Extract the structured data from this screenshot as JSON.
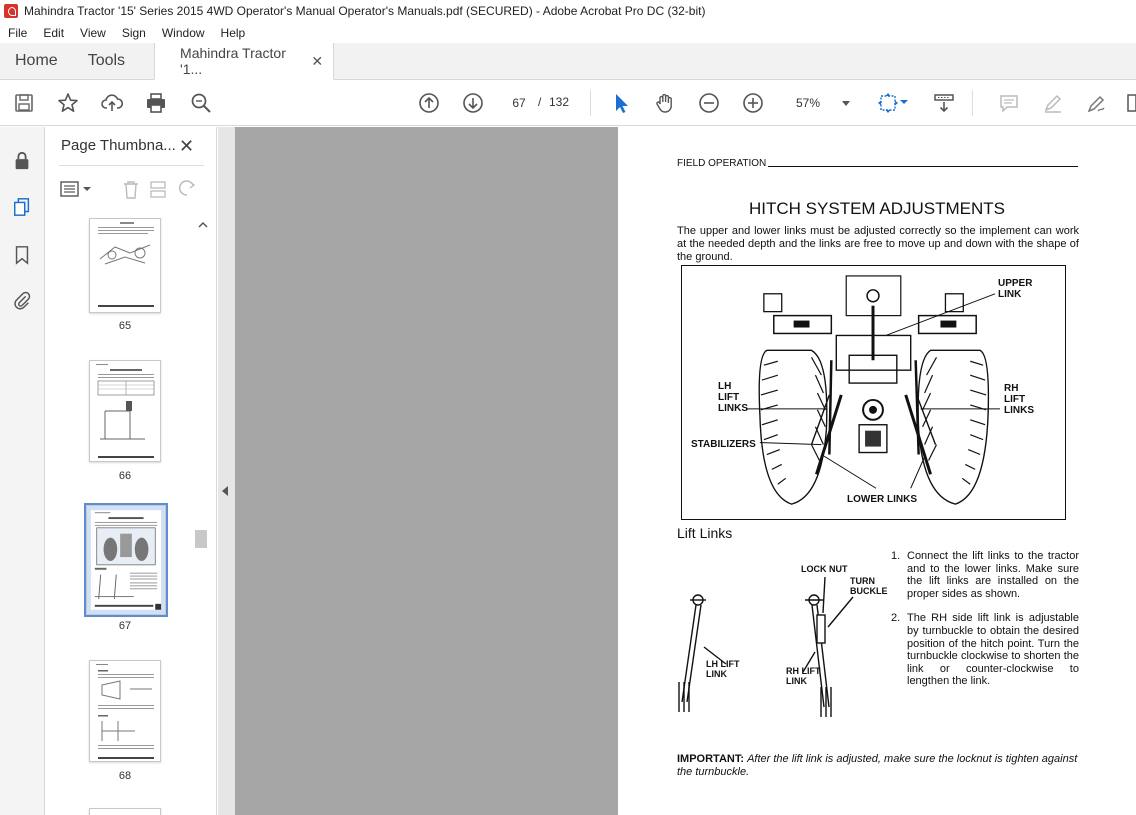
{
  "window": {
    "title": "Mahindra Tractor '15' Series 2015 4WD Operator's Manual Operator's Manuals.pdf (SECURED) - Adobe Acrobat Pro DC (32-bit)"
  },
  "menu": [
    "File",
    "Edit",
    "View",
    "Sign",
    "Window",
    "Help"
  ],
  "tabs": {
    "home": "Home",
    "tools": "Tools",
    "doc": "Mahindra Tractor '1..."
  },
  "toolbar": {
    "current_page": "67",
    "page_sep": "/",
    "total_pages": "132",
    "zoom": "57%"
  },
  "panel": {
    "title": "Page Thumbna...",
    "thumbnails": [
      {
        "label": "65"
      },
      {
        "label": "66"
      },
      {
        "label": "67",
        "selected": true
      },
      {
        "label": "68"
      }
    ]
  },
  "page": {
    "section": "FIELD OPERATION",
    "heading": "HITCH SYSTEM ADJUSTMENTS",
    "intro": "The upper and lower links must be adjusted correctly so the implement can work at the needed depth and the links are free to move up and down with the shape of the ground.",
    "figure_labels": {
      "upper": "UPPER\nLINK",
      "lh": "LH\nLIFT\nLINKS",
      "rh": "RH\nLIFT\nLINKS",
      "stabilizers": "STABILIZERS",
      "lower": "LOWER LINKS"
    },
    "subheading": "Lift Links",
    "lift_labels": {
      "lock_nut": "LOCK NUT",
      "turn_buckle": "TURN\nBUCKLE",
      "lh_lift": "LH LIFT\nLINK",
      "rh_lift": "RH LIFT\nLINK"
    },
    "steps": [
      {
        "num": "1.",
        "text": "Connect the lift links to the tractor and to the lower links. Make sure the lift links are installed on the proper sides as shown."
      },
      {
        "num": "2.",
        "text": "The RH side lift link is adjustable by turnbuckle to obtain the desired position of the hitch point. Turn the turnbuckle clockwise to shorten the link or counter-clockwise to lengthen the link."
      }
    ],
    "important_label": "IMPORTANT:",
    "important_text": "After the lift link is adjusted, make sure the locknut is tighten against the turnbuckle."
  },
  "colors": {
    "acrobat_red": "#d9322b",
    "selection_blue": "#5b8ed6",
    "cursor_blue": "#1a6fd1"
  }
}
